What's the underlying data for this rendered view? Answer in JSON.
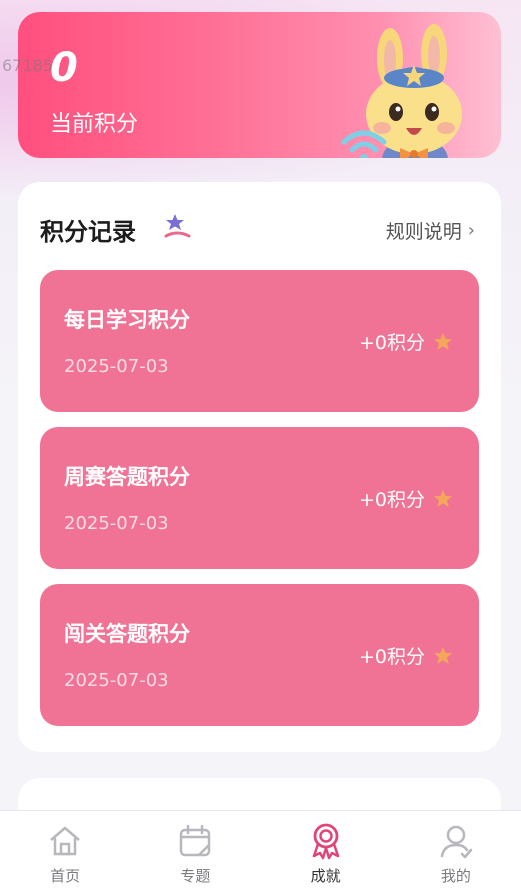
{
  "background_ghost_text": "67185",
  "score": {
    "value": "0",
    "label": "当前积分"
  },
  "records": {
    "title": "积分记录",
    "rules_link": "规则说明",
    "items": [
      {
        "name": "每日学习积分",
        "date": "2025-07-03",
        "points": "+0积分"
      },
      {
        "name": "周赛答题积分",
        "date": "2025-07-03",
        "points": "+0积分"
      },
      {
        "name": "闯关答题积分",
        "date": "2025-07-03",
        "points": "+0积分"
      }
    ]
  },
  "tabbar": {
    "tabs": [
      {
        "label": "首页",
        "icon": "home-icon",
        "active": false
      },
      {
        "label": "专题",
        "icon": "calendar-icon",
        "active": false
      },
      {
        "label": "成就",
        "icon": "medal-icon",
        "active": true
      },
      {
        "label": "我的",
        "icon": "user-icon",
        "active": false
      }
    ]
  },
  "colors": {
    "card_pink": "#f07395",
    "score_gradient_start": "#ff4f7e",
    "active_tab": "#e0457a",
    "star": "#f4a65a"
  }
}
